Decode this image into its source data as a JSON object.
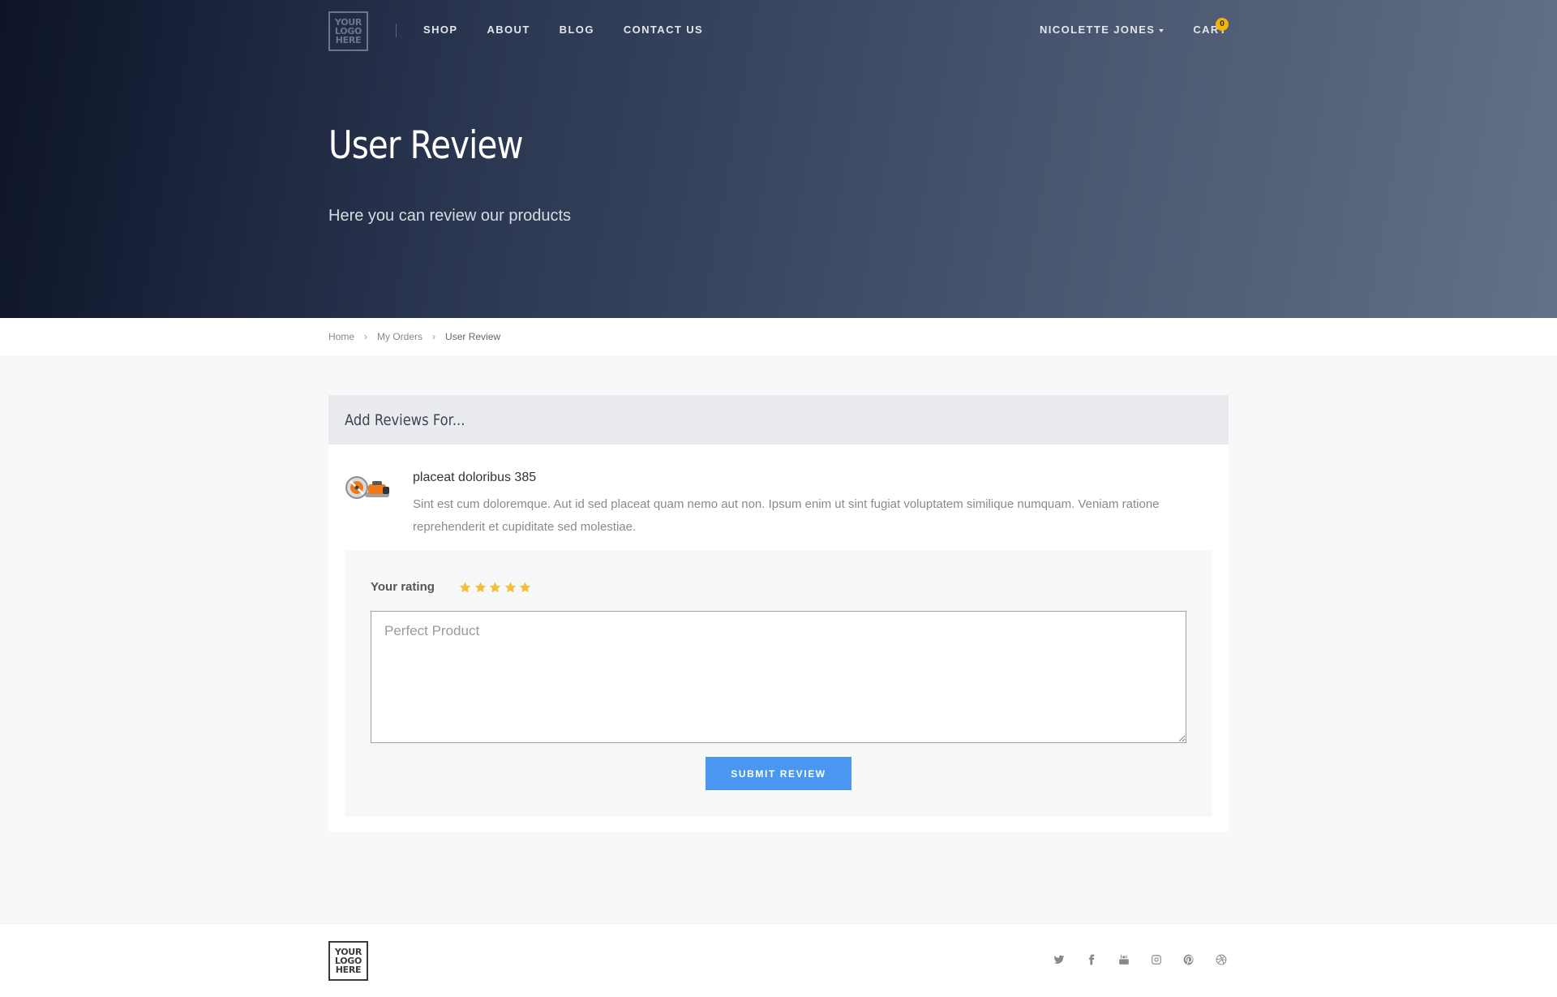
{
  "header": {
    "logo": [
      "YOUR",
      "LOGO",
      "HERE"
    ],
    "nav": {
      "shop": "SHOP",
      "about": "ABOUT",
      "blog": "BLOG",
      "contact": "CONTACT US"
    },
    "user_name": "NICOLETTE JONES",
    "cart_label": "CART",
    "cart_count": "0"
  },
  "hero": {
    "title": "User Review",
    "subtitle": "Here you can review our products"
  },
  "breadcrumb": {
    "home": "Home",
    "orders": "My Orders",
    "current": "User Review"
  },
  "card": {
    "heading": "Add Reviews For...",
    "product": {
      "image_icon": "chainsaw-product-icon",
      "name": "placeat doloribus 385",
      "description": "Sint est cum doloremque. Aut id sed placeat quam nemo aut non. Ipsum enim ut sint fugiat voluptatem similique numquam. Veniam ratione reprehenderit et cupiditate sed molestiae."
    },
    "review": {
      "rating_label": "Your rating",
      "rating": 5,
      "rating_max": 5,
      "placeholder": "Perfect Product",
      "submit_label": "SUBMIT REVIEW"
    }
  },
  "footer": {
    "logo": [
      "YOUR",
      "LOGO",
      "HERE"
    ],
    "socials": [
      "twitter-icon",
      "facebook-icon",
      "youtube-icon",
      "instagram-icon",
      "pinterest-icon",
      "dribbble-icon"
    ]
  },
  "colors": {
    "accent": "#4a97f1",
    "badge": "#f6b500",
    "star": "#f5bd3a"
  }
}
